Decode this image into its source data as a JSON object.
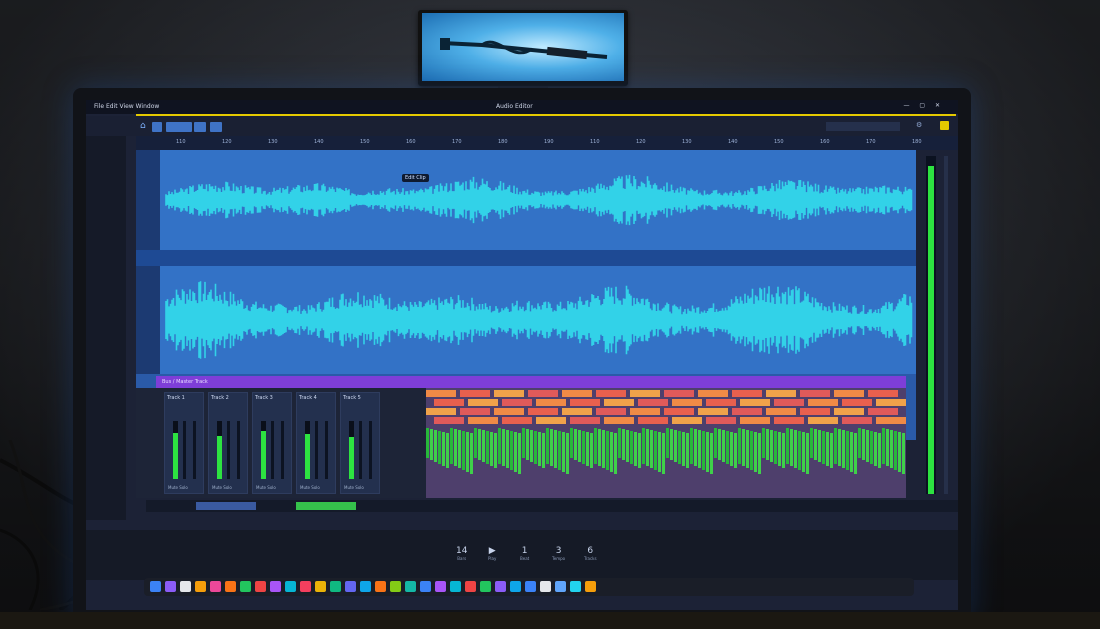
{
  "window": {
    "title": "Audio Editor",
    "menu": "File Edit View Window",
    "controls": "— ▢ ✕"
  },
  "toolbar": {
    "buttons": [
      "",
      "",
      "",
      ""
    ],
    "search": ""
  },
  "sidebar": {
    "items": [
      "",
      "",
      "",
      "",
      "",
      "",
      "",
      "",
      ""
    ]
  },
  "ruler": {
    "ticks": [
      "110",
      "120",
      "130",
      "140",
      "150",
      "160",
      "170",
      "180",
      "190",
      "110",
      "120",
      "130",
      "140",
      "150",
      "160",
      "170",
      "180",
      "190",
      "120"
    ]
  },
  "tracks": {
    "clip_label": "Edit Clip",
    "bus_label": "Bus / Master Track",
    "colors": {
      "lane": "#3372c6",
      "wave": "#32d2e8",
      "gutter": "#1c3a72"
    }
  },
  "mixer": {
    "strips": [
      {
        "name": "Track 1",
        "level": 0.8,
        "foot": "Mute Solo"
      },
      {
        "name": "Track 2",
        "level": 0.75,
        "foot": "Mute Solo"
      },
      {
        "name": "Track 3",
        "level": 0.82,
        "foot": "Mute Solo"
      },
      {
        "name": "Track 4",
        "level": 0.78,
        "foot": "Mute Solo"
      },
      {
        "name": "Track 5",
        "level": 0.72,
        "foot": "Mute Solo"
      }
    ]
  },
  "master_meter": {
    "level": 0.97,
    "color": "#2de341"
  },
  "transport": {
    "items": [
      {
        "value": "14",
        "label": "Bars"
      },
      {
        "value": "▶",
        "label": "Play"
      },
      {
        "value": "1",
        "label": "Beat"
      },
      {
        "value": "3",
        "label": "Tempo"
      },
      {
        "value": "6",
        "label": "Tracks"
      }
    ]
  },
  "dock": {
    "icon_colors": [
      "#3b82f6",
      "#8b5cf6",
      "#e5e7eb",
      "#f59e0b",
      "#ec4899",
      "#f97316",
      "#22c55e",
      "#ef4444",
      "#a855f7",
      "#06b6d4",
      "#f43f5e",
      "#eab308",
      "#10b981",
      "#6366f1",
      "#0ea5e9",
      "#f97316",
      "#84cc16",
      "#14b8a6",
      "#3b82f6",
      "#a855f7",
      "#06b6d4",
      "#ef4444",
      "#22c55e",
      "#8b5cf6",
      "#0ea5e9",
      "#3b82f6",
      "#e5e7eb",
      "#60a5fa",
      "#22d3ee",
      "#f59e0b"
    ]
  }
}
